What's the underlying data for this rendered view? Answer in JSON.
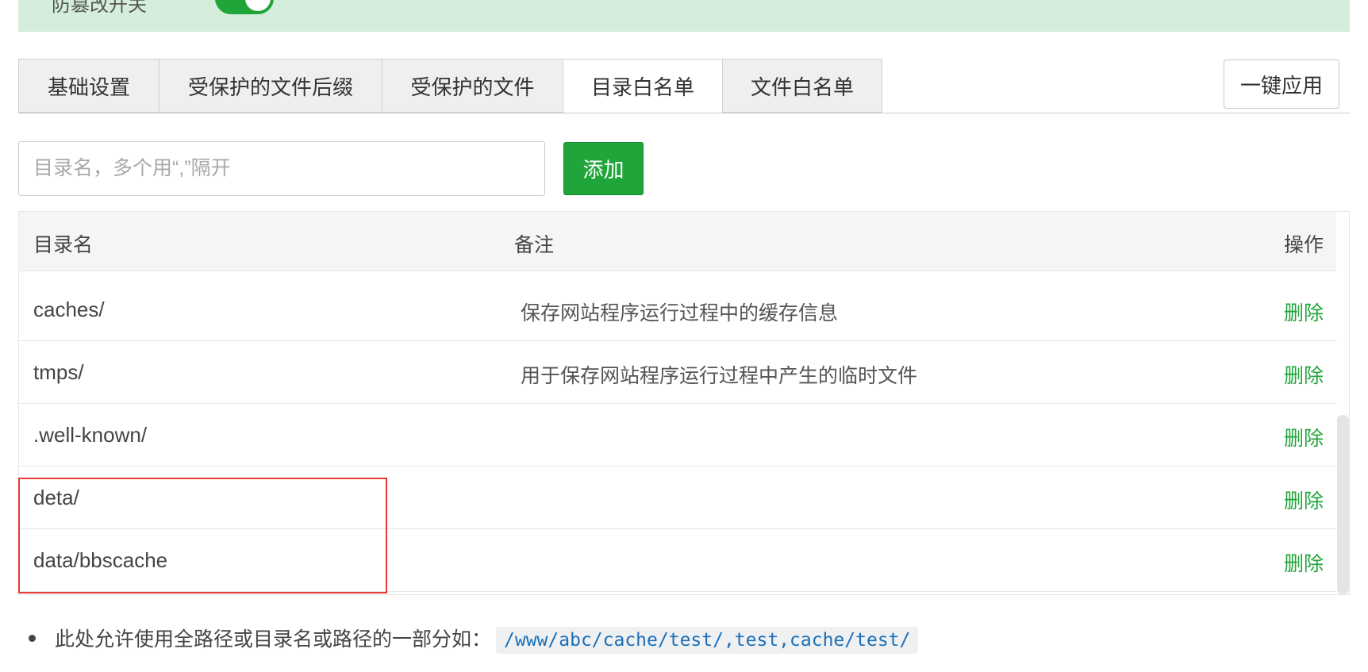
{
  "top_bar": {
    "label": "防篡改开关",
    "toggle_on": true,
    "colors": {
      "background": "#d4eedb",
      "toggle": "#20a53a"
    }
  },
  "tabs": [
    {
      "label": "基础设置",
      "active": false
    },
    {
      "label": "受保护的文件后缀",
      "active": false
    },
    {
      "label": "受保护的文件",
      "active": false
    },
    {
      "label": "目录白名单",
      "active": true
    },
    {
      "label": "文件白名单",
      "active": false
    }
  ],
  "toolbar": {
    "apply_label": "一键应用"
  },
  "add_form": {
    "placeholder": "目录名，多个用“,”隔开",
    "value": "",
    "add_label": "添加"
  },
  "table": {
    "headers": {
      "name": "目录名",
      "note": "备注",
      "op": "操作"
    },
    "rows": [
      {
        "name": "caches/",
        "note": "保存网站程序运行过程中的缓存信息",
        "op": "删除"
      },
      {
        "name": "tmps/",
        "note": "用于保存网站程序运行过程中产生的临时文件",
        "op": "删除"
      },
      {
        "name": ".well-known/",
        "note": "",
        "op": "删除"
      },
      {
        "name": "deta/",
        "note": "",
        "op": "删除"
      },
      {
        "name": "data/bbscache",
        "note": "",
        "op": "删除"
      }
    ]
  },
  "notes": [
    {
      "text": "此处允许使用全路径或目录名或路径的一部分如：",
      "code": "/www/abc/cache/test/,test,cache/test/"
    }
  ],
  "colors": {
    "accent": "#20a53a",
    "highlight": "#e53935",
    "code": "#1b6fb8"
  }
}
